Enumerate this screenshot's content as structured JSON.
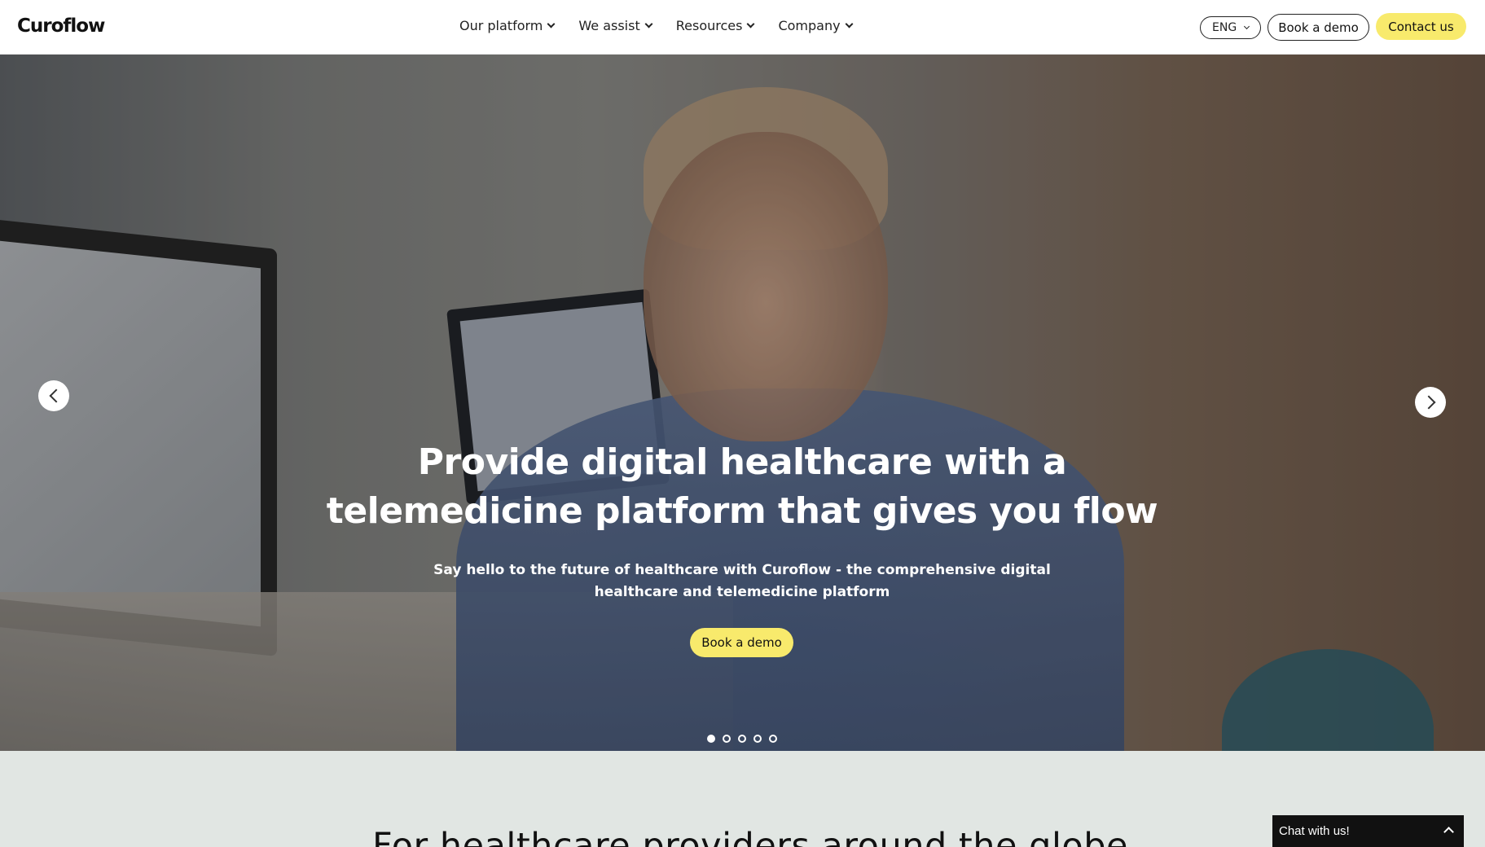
{
  "header": {
    "logo": "Curoflow",
    "nav": [
      {
        "label": "Our platform"
      },
      {
        "label": "We assist"
      },
      {
        "label": "Resources"
      },
      {
        "label": "Company"
      }
    ],
    "language": "ENG",
    "book_demo_label": "Book a demo",
    "contact_label": "Contact us"
  },
  "hero": {
    "title_line1": "Provide digital healthcare with a",
    "title_line2": "telemedicine platform that gives you flow",
    "subtitle_line1": "Say hello to the future of healthcare with Curoflow - the comprehensive digital",
    "subtitle_line2": "healthcare and telemedicine platform",
    "cta_label": "Book a demo",
    "slides_total": 5,
    "active_slide": 1
  },
  "section": {
    "heading": "For healthcare providers around the globe"
  },
  "chat": {
    "label": "Chat with us!"
  },
  "colors": {
    "accent_yellow": "#f8ea6c",
    "section_bg": "#e1e6e3",
    "chat_bg": "#111111"
  }
}
